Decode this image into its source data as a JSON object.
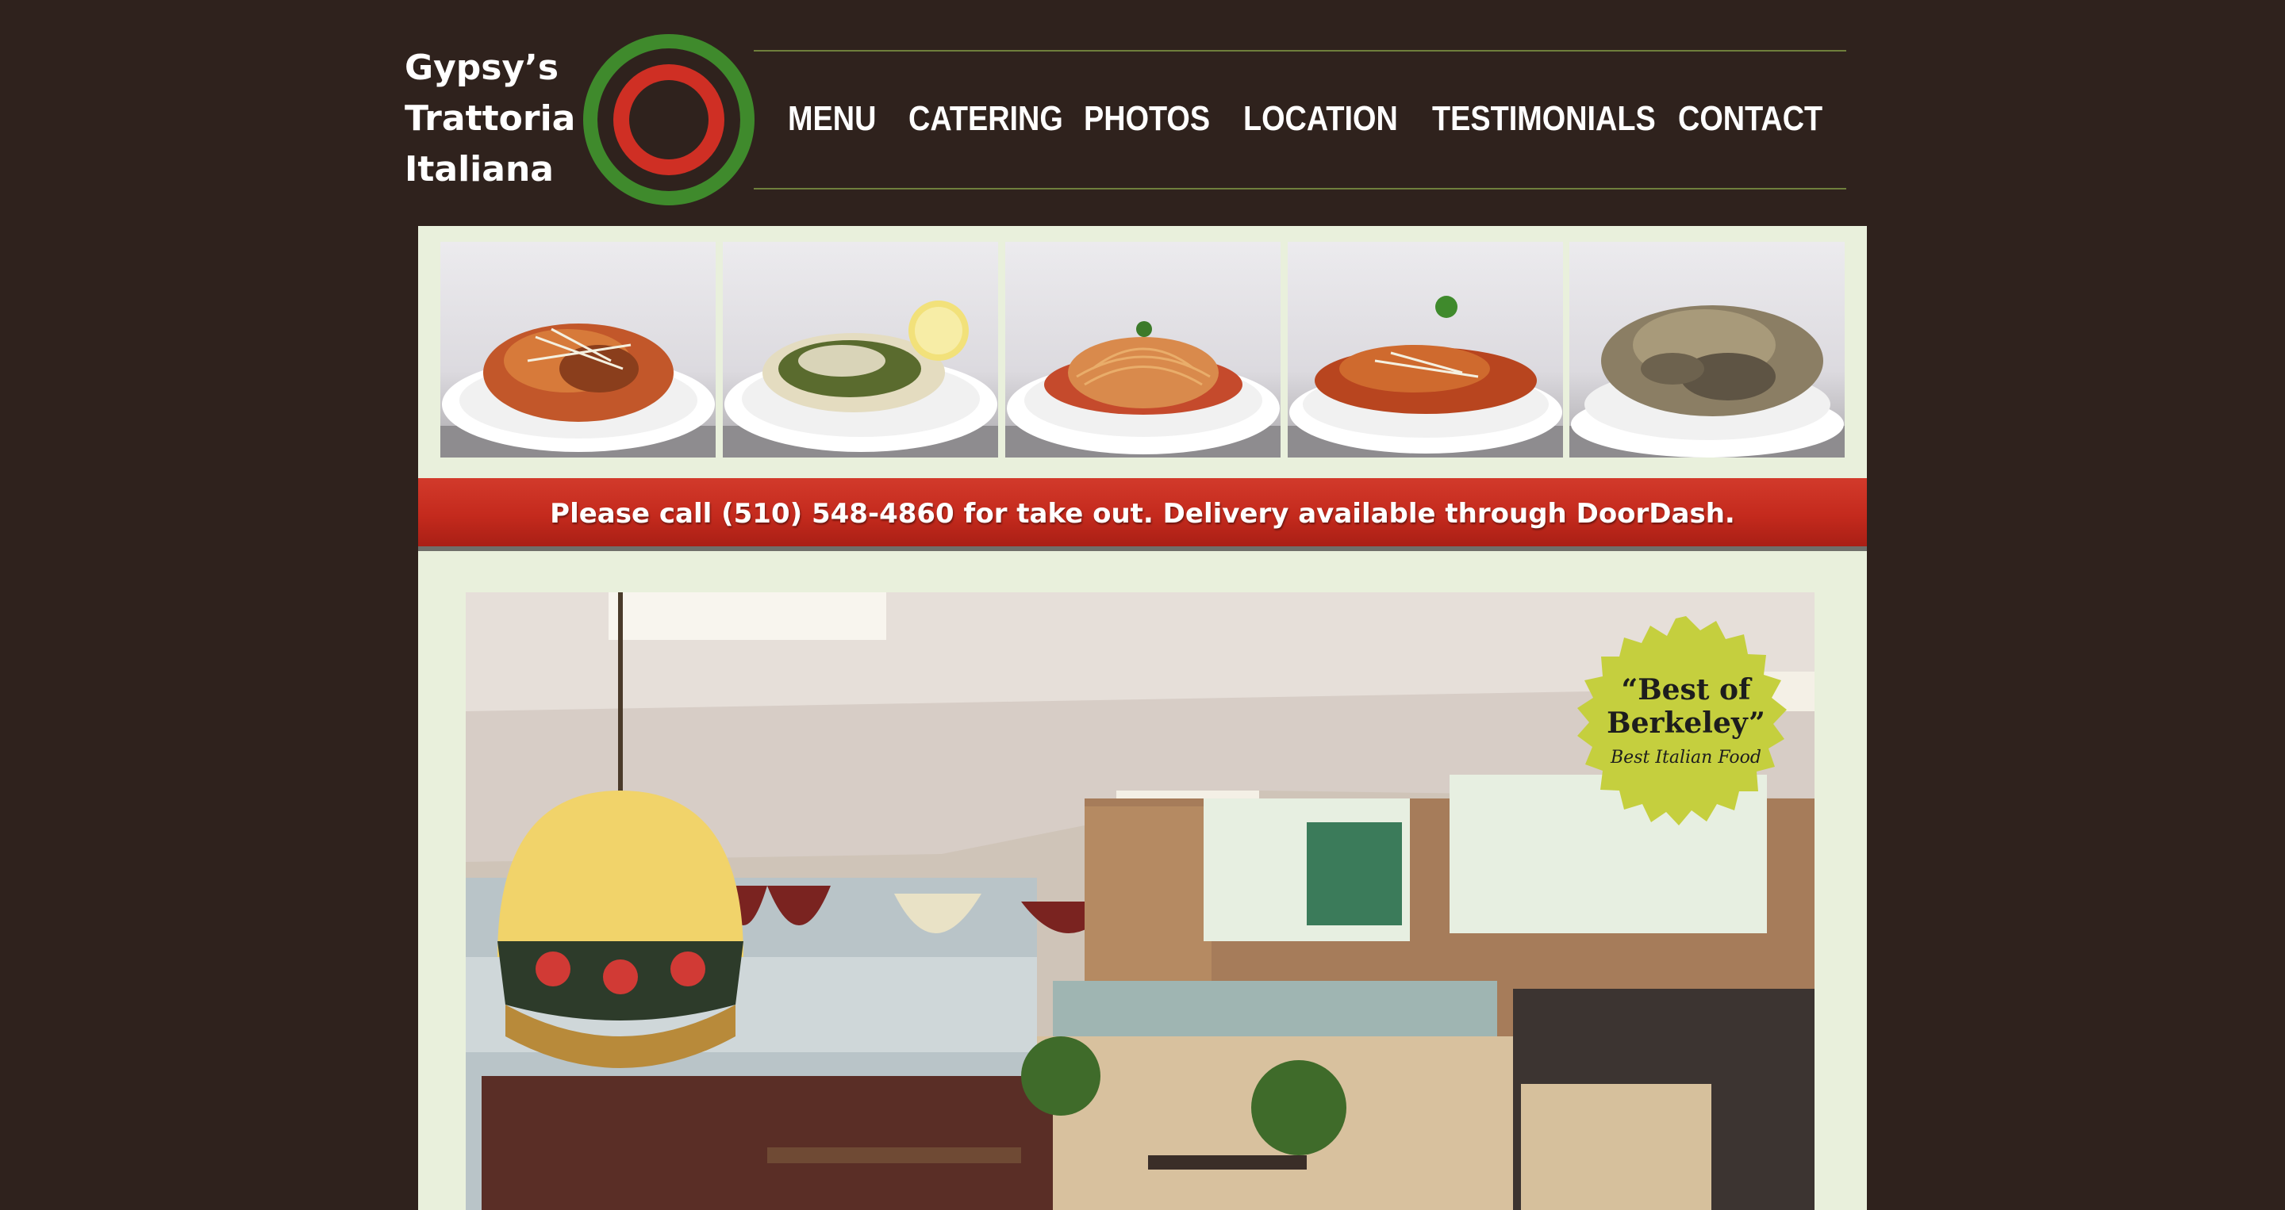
{
  "brand": {
    "line1": "Gypsy’s",
    "line2": "Trattoria",
    "line3": "Italiana",
    "colors": {
      "ring_outer": "#3f8a2c",
      "ring_mid": "#2f221d",
      "ring_red": "#cf2f24"
    }
  },
  "nav": {
    "items": [
      {
        "label": "MENU"
      },
      {
        "label": "CATERING"
      },
      {
        "label": "PHOTOS"
      },
      {
        "label": "LOCATION"
      },
      {
        "label": "TESTIMONIALS"
      },
      {
        "label": "CONTACT"
      }
    ]
  },
  "gallery": {
    "thumbs": [
      {
        "dish": "penne-meat-sauce"
      },
      {
        "dish": "spaghetti-capers-lemon"
      },
      {
        "dish": "spaghetti-tomato-sauce"
      },
      {
        "dish": "ravioli-meat-sauce"
      },
      {
        "dish": "pasta-chicken-mushroom"
      }
    ]
  },
  "notice": {
    "text": "Please call (510) 548-4860 for take out. Delivery available through DoorDash."
  },
  "hero": {
    "badge_title": "“Best of Berkeley”",
    "badge_title_line1": "“Best of",
    "badge_title_line2": "Berkeley”",
    "badge_subtitle": "Best Italian Food"
  },
  "colors": {
    "page_bg": "#2f221d",
    "panel_bg": "#e9f0dc",
    "banner_red": "#c42a1d",
    "badge_green": "#c5cf3e"
  }
}
